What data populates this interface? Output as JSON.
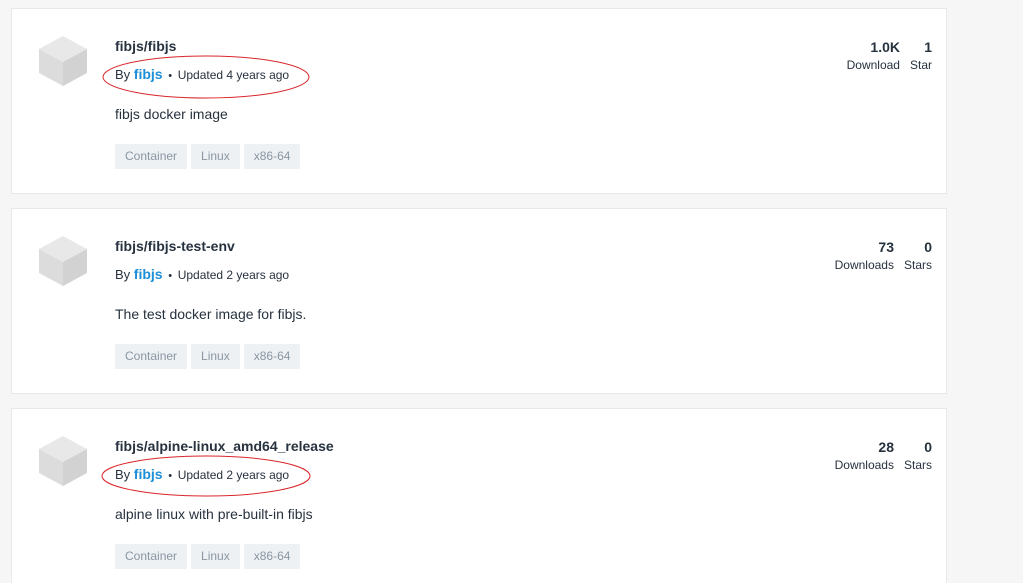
{
  "repos": [
    {
      "name": "fibjs/fibjs",
      "by_prefix": "By",
      "publisher": "fibjs",
      "dot": "•",
      "updated": "Updated 4 years ago",
      "description": "fibjs docker image",
      "tags": [
        "Container",
        "Linux",
        "x86-64"
      ],
      "downloads": {
        "value": "1.0K",
        "label": "Download"
      },
      "stars": {
        "value": "1",
        "label": "Star"
      }
    },
    {
      "name": "fibjs/fibjs-test-env",
      "by_prefix": "By",
      "publisher": "fibjs",
      "dot": "•",
      "updated": "Updated 2 years ago",
      "description": "The test docker image for fibjs.",
      "tags": [
        "Container",
        "Linux",
        "x86-64"
      ],
      "downloads": {
        "value": "73",
        "label": "Downloads"
      },
      "stars": {
        "value": "0",
        "label": "Stars"
      }
    },
    {
      "name": "fibjs/alpine-linux_amd64_release",
      "by_prefix": "By",
      "publisher": "fibjs",
      "dot": "•",
      "updated": "Updated 2 years ago",
      "description": "alpine linux with pre-built-in fibjs",
      "tags": [
        "Container",
        "Linux",
        "x86-64"
      ],
      "downloads": {
        "value": "28",
        "label": "Downloads"
      },
      "stars": {
        "value": "0",
        "label": "Stars"
      }
    }
  ],
  "annotation_color": "#d9262b",
  "link_color": "#1d8fd6"
}
